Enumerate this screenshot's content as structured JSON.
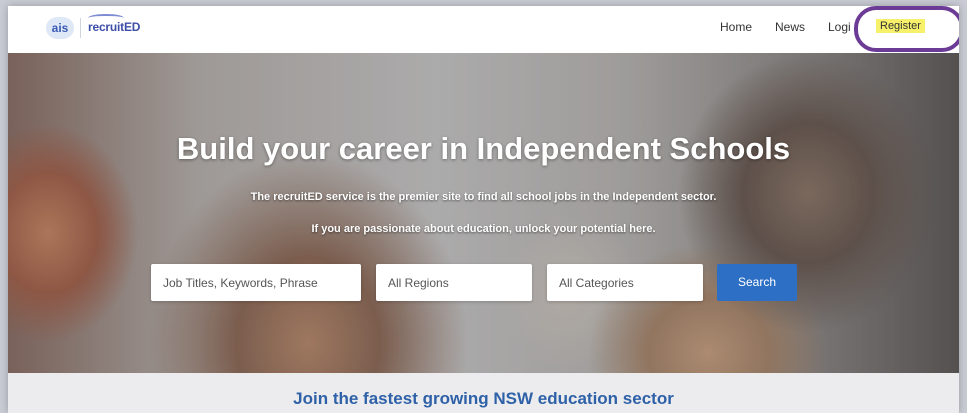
{
  "header": {
    "logo_ais": "ais",
    "logo_recruited": "recruitED",
    "nav": {
      "home": "Home",
      "news": "News",
      "login": "Logi",
      "register": "Register"
    },
    "highlight_color": "#f6f06a",
    "annotation_circle_color": "#6b3b96"
  },
  "hero": {
    "title": "Build your career in Independent Schools",
    "subtitle_1": "The recruitED service is the premier site to find all school jobs in the Independent sector.",
    "subtitle_2": "If you are passionate about education, unlock your potential here.",
    "search": {
      "keywords_placeholder": "Job Titles, Keywords, Phrase",
      "regions_selected": "All Regions",
      "categories_selected": "All Categories",
      "button_label": "Search"
    },
    "accent_color": "#2d6fc4"
  },
  "band": {
    "title": "Join the fastest growing NSW education sector"
  }
}
